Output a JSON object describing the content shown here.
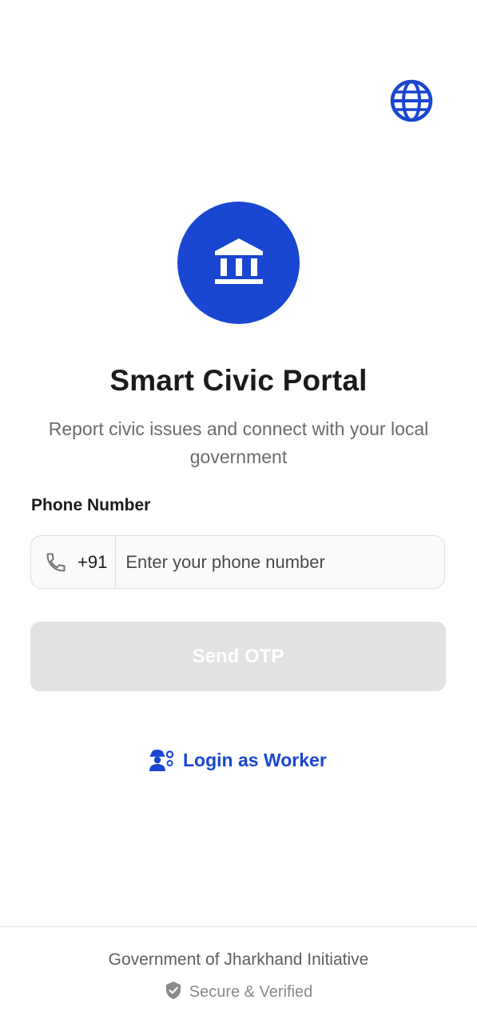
{
  "header": {
    "language_icon": "globe-icon"
  },
  "branding": {
    "logo_icon": "government-building-icon",
    "title": "Smart Civic Portal",
    "subtitle": "Report civic issues and connect with your local government"
  },
  "login_form": {
    "phone_label": "Phone Number",
    "phone_icon": "phone-icon",
    "country_code": "+91",
    "phone_placeholder": "Enter your phone number",
    "phone_value": "",
    "send_otp_label": "Send OTP",
    "send_otp_enabled": false
  },
  "worker_login": {
    "icon": "worker-icon",
    "label": "Login as Worker"
  },
  "footer": {
    "initiative": "Government of Jharkhand Initiative",
    "secure_icon": "shield-check-icon",
    "secure_label": "Secure & Verified"
  },
  "colors": {
    "primary": "#1a47d1",
    "button_disabled": "#e2e2e2",
    "muted_text": "#6b6b6b"
  }
}
